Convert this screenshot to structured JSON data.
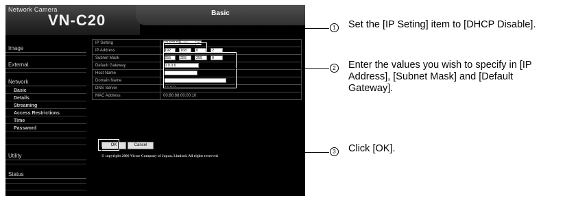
{
  "header": {
    "brand": "Network Camera",
    "model": "VN-C20",
    "page_title": "Basic"
  },
  "sidebar": {
    "items": [
      {
        "label": "Image"
      },
      {
        "label": "External"
      },
      {
        "label": "Network"
      },
      {
        "label": "Basic"
      },
      {
        "label": "Details"
      },
      {
        "label": "Streaming"
      },
      {
        "label": "Access Restrictions"
      },
      {
        "label": "Time"
      },
      {
        "label": "Password"
      },
      {
        "label": "Utility"
      },
      {
        "label": "Status"
      }
    ]
  },
  "form": {
    "ip_setting": {
      "label": "IP Setting",
      "value": "DHCP Disable"
    },
    "ip_address": {
      "label": "IP Address",
      "values": [
        "192",
        "168",
        "0",
        "2"
      ]
    },
    "subnet_mask": {
      "label": "Subnet Mask",
      "values": [
        "255",
        "255",
        "255",
        "0"
      ]
    },
    "default_gateway": {
      "label": "Default Gateway",
      "value": "0.0.0.0"
    },
    "host_name": {
      "label": "Host Name",
      "value": ""
    },
    "domain_name": {
      "label": "Domain Name",
      "value": ""
    },
    "dns_server": {
      "label": "DNS Server",
      "value": "0.0.0.0"
    },
    "mac_address": {
      "label": "MAC Address",
      "value": "00:80:88:00:00:10"
    }
  },
  "buttons": {
    "ok": "OK",
    "cancel": "Cancel"
  },
  "copyright": "© copyright 2006 Victor Company of Japan, Limited, All rights reserved",
  "callouts": [
    {
      "num": "1",
      "text": "Set the [IP Seting] item to [DHCP Disable]."
    },
    {
      "num": "2",
      "text": "Enter the values you wish to specify in [IP Address], [Subnet Mask] and [Default Gateway]."
    },
    {
      "num": "3",
      "text": "Click [OK]."
    }
  ]
}
